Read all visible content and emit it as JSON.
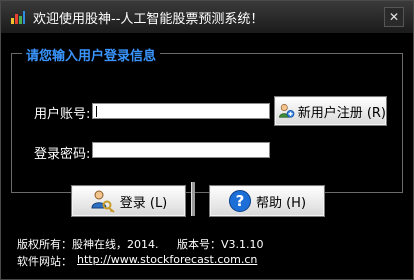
{
  "window": {
    "title": "欢迎使用股神--人工智能股票预测系统！",
    "close_symbol": "✕"
  },
  "login_group": {
    "title": "请您输入用户登录信息",
    "account_label": "用户账号:",
    "account_value": "",
    "password_label": "登录密码:",
    "password_value": ""
  },
  "buttons": {
    "register": "新用户注册 (R)",
    "login": "登录 (L)",
    "help": "帮助 (H)"
  },
  "footer": {
    "copyright": "版权所有：股神在线，2014.",
    "version": "版本号：V3.1.10",
    "website_label": "软件网站：",
    "website_url": "http://www.stockforecast.com.cn"
  },
  "icons": {
    "app": "bar-chart-icon",
    "register": "add-user-icon",
    "login": "users-key-icon",
    "help": "question-mark-icon"
  }
}
